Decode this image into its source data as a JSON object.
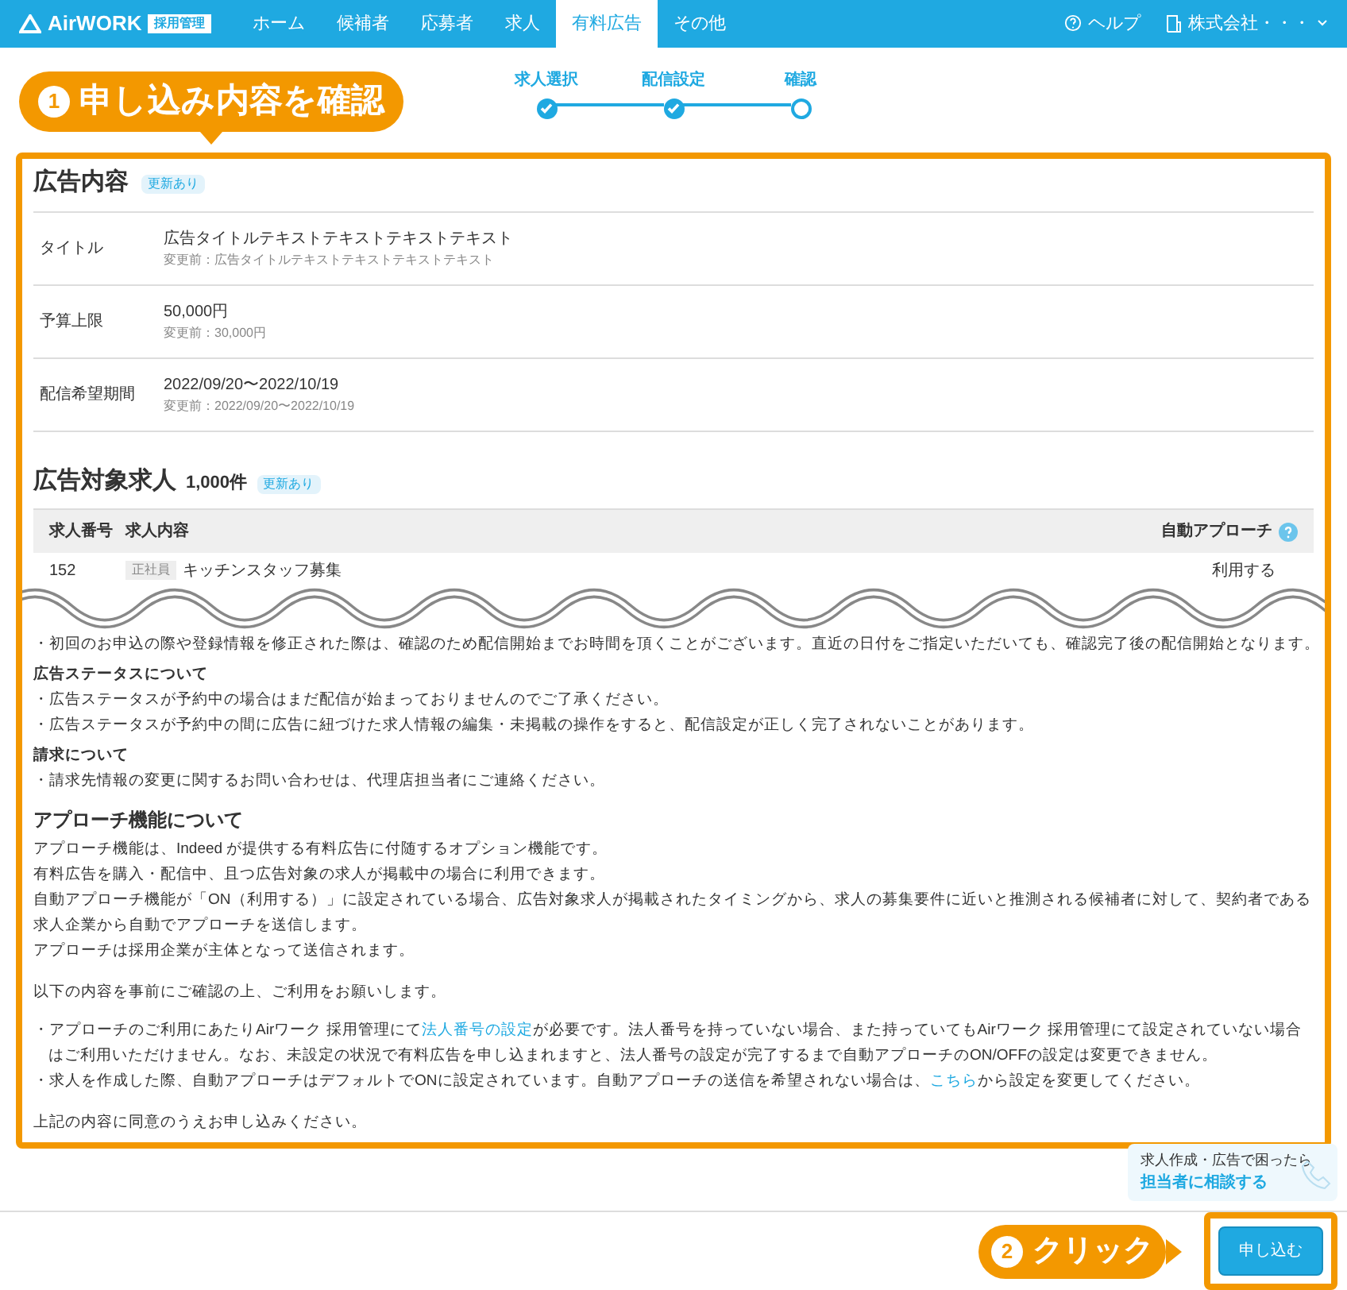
{
  "nav": {
    "logo": "AirWORK",
    "logo_badge": "採用管理",
    "items": [
      {
        "label": "ホーム",
        "selected": false
      },
      {
        "label": "候補者",
        "selected": false
      },
      {
        "label": "応募者",
        "selected": false
      },
      {
        "label": "求人",
        "selected": false
      },
      {
        "label": "有料広告",
        "selected": true
      },
      {
        "label": "その他",
        "selected": false
      }
    ],
    "help": "ヘルプ",
    "company": "株式会社・・・"
  },
  "callouts": [
    {
      "number": "1",
      "text": "申し込み内容を確認"
    },
    {
      "number": "2",
      "text": "クリック"
    }
  ],
  "steps": [
    {
      "label": "求人選択",
      "completed": true
    },
    {
      "label": "配信設定",
      "completed": true
    },
    {
      "label": "確認",
      "completed": false
    }
  ],
  "ad_section": {
    "title": "広告内容",
    "badge": "更新あり",
    "rows": [
      {
        "label": "タイトル",
        "value": "広告タイトルテキストテキストテキストテキスト",
        "previous": "変更前：広告タイトルテキストテキストテキストテキスト"
      },
      {
        "label": "予算上限",
        "value": "50,000円",
        "previous": "変更前：30,000円"
      },
      {
        "label": "配信希望期間",
        "value": "2022/09/20〜2022/10/19",
        "previous": "変更前：2022/09/20〜2022/10/19"
      }
    ]
  },
  "jobs_section": {
    "title": "広告対象求人",
    "count": "1,000件",
    "badge": "更新あり",
    "columns": [
      "求人番号",
      "求人内容",
      "自動アプローチ"
    ],
    "rows": [
      {
        "number": "152",
        "tag": "正社員",
        "title": "キッチンスタッフ募集",
        "approach": "利用する"
      }
    ]
  },
  "notes": [
    {
      "kind": "bullet",
      "text": "・初回のお申込の際や登録情報を修正された際は、確認のため配信開始までお時間を頂くことがございます。直近の日付をご指定いただいても、確認完了後の配信開始となります。"
    },
    {
      "kind": "heading",
      "text": "広告ステータスについて"
    },
    {
      "kind": "bullet",
      "text": "・広告ステータスが予約中の場合はまだ配信が始まっておりませんのでご了承ください。"
    },
    {
      "kind": "bullet",
      "text": "・広告ステータスが予約中の間に広告に紐づけた求人情報の編集・未掲載の操作をすると、配信設定が正しく完了されないことがあります。"
    },
    {
      "kind": "heading",
      "text": "請求について"
    },
    {
      "kind": "bullet",
      "text": "・請求先情報の変更に関するお問い合わせは、代理店担当者にご連絡ください。"
    }
  ],
  "approach": {
    "title": "アプローチ機能について",
    "paragraphs": [
      "アプローチ機能は、Indeed が提供する有料広告に付随するオプション機能です。",
      "有料広告を購入・配信中、且つ広告対象の求人が掲載中の場合に利用できます。",
      "自動アプローチ機能が「ON（利用する）」に設定されている場合、広告対象求人が掲載されたタイミングから、求人の募集要件に近いと推測される候補者に対して、契約者である求人企業から自動でアプローチを送信します。",
      "アプローチは採用企業が主体となって送信されます。"
    ],
    "intro": "以下の内容を事前にご確認の上、ご利用をお願いします。",
    "bullets": [
      [
        {
          "kind": "text",
          "text": "・アプローチのご利用にあたりAirワーク 採用管理にて"
        },
        {
          "kind": "link",
          "text": "法人番号の設定"
        },
        {
          "kind": "text",
          "text": "が必要です。法人番号を持っていない場合、また持っていてもAirワーク 採用管理にて設定されていない場合はご利用いただけません。なお、未設定の状況で有料広告を申し込まれますと、法人番号の設定が完了するまで自動アプローチのON/OFFの設定は変更できません。"
        }
      ],
      [
        {
          "kind": "text",
          "text": "・求人を作成した際、自動アプローチはデフォルトでONに設定されています。自動アプローチの送信を希望されない場合は、"
        },
        {
          "kind": "link",
          "text": "こちら"
        },
        {
          "kind": "text",
          "text": "から設定を変更してください。"
        }
      ]
    ],
    "closing": "上記の内容に同意のうえお申し込みください。"
  },
  "help_widget": {
    "line1": "求人作成・広告で困ったら",
    "line2": "担当者に相談する"
  },
  "submit": "申し込む"
}
